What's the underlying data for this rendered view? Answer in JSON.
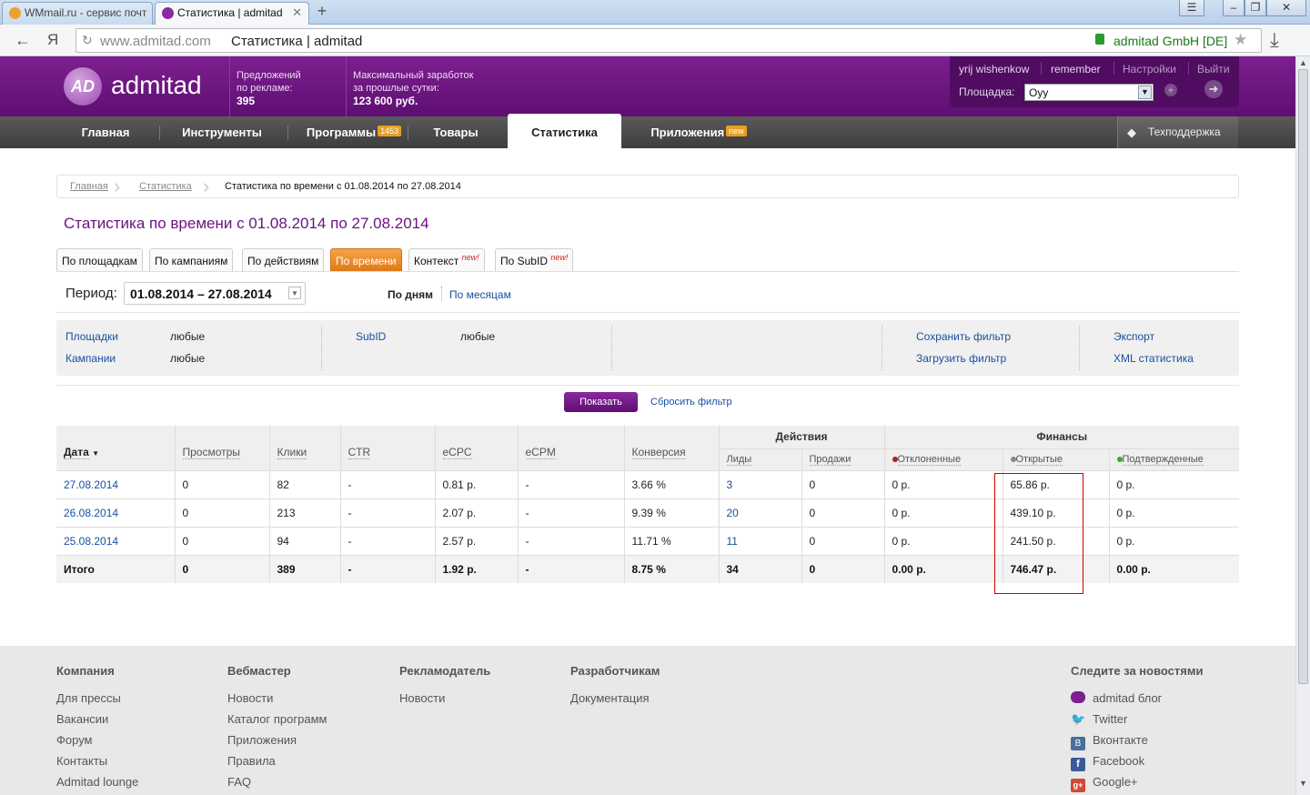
{
  "browser": {
    "tabs": [
      {
        "title": "WMmail.ru - сервис почт",
        "active": false
      },
      {
        "title": "Статистика | admitad",
        "active": true
      }
    ],
    "url_domain": "www.admitad.com",
    "url_title": "Статистика | admitad",
    "cert_label": "admitad GmbH [DE]",
    "yandex_label": "Я"
  },
  "header": {
    "logo_text": "admitad",
    "logo_mark": "AD",
    "offers_label_1": "Предложений",
    "offers_label_2": "по рекламе:",
    "offers_value": "395",
    "earn_label_1": "Максимальный заработок",
    "earn_label_2": "за прошлые сутки:",
    "earn_value": "123 600 руб.",
    "user": "yrij wishenkow",
    "remember": "remember",
    "settings": "Настройки",
    "logout": "Выйти",
    "platform_label": "Площадка:",
    "platform_value": "Oyy"
  },
  "nav": {
    "items": [
      {
        "label": "Главная",
        "badge": ""
      },
      {
        "label": "Инструменты",
        "badge": ""
      },
      {
        "label": "Программы",
        "badge": "1453"
      },
      {
        "label": "Товары",
        "badge": ""
      },
      {
        "label": "Статистика",
        "badge": ""
      },
      {
        "label": "Приложения",
        "badge": "new"
      }
    ],
    "support": "Техподдержка"
  },
  "breadcrumb": {
    "home": "Главная",
    "stats": "Статистика",
    "current": "Статистика по времени с 01.08.2014 по 27.08.2014"
  },
  "page_title": "Статистика по времени с 01.08.2014 по 27.08.2014",
  "subtabs": [
    {
      "label": "По площадкам",
      "new": ""
    },
    {
      "label": "По кампаниям",
      "new": ""
    },
    {
      "label": "По действиям",
      "new": ""
    },
    {
      "label": "По времени",
      "new": ""
    },
    {
      "label": "Контекст",
      "new": "new!"
    },
    {
      "label": "По SubID",
      "new": "new!"
    }
  ],
  "period": {
    "label": "Период:",
    "value": "01.08.2014 – 27.08.2014",
    "by_days": "По дням",
    "by_months": "По месяцам"
  },
  "filter": {
    "sites_label": "Площадки",
    "sites_value": "любые",
    "campaigns_label": "Кампании",
    "campaigns_value": "любые",
    "subid_label": "SubID",
    "subid_value": "любые",
    "save_filter": "Сохранить фильтр",
    "load_filter": "Загрузить фильтр",
    "export": "Экспорт",
    "xml": "XML статистика",
    "show_button": "Показать",
    "reset": "Сбросить фильтр"
  },
  "table": {
    "group_actions": "Действия",
    "group_finance": "Финансы",
    "headers": [
      "Дата",
      "Просмотры",
      "Клики",
      "CTR",
      "eCPC",
      "eCPM",
      "Конверсия"
    ],
    "sub_headers": [
      "Лиды",
      "Продажи",
      "Отклоненные",
      "Открытые",
      "Подтвержденные"
    ],
    "status_colors": {
      "rejected": "#b22222",
      "open": "#888888",
      "confirmed": "#33aa33"
    },
    "rows": [
      [
        "27.08.2014",
        "0",
        "82",
        "-",
        "0.81 р.",
        "-",
        "3.66 %",
        "3",
        "0",
        "0 р.",
        "65.86 р.",
        "0 р."
      ],
      [
        "26.08.2014",
        "0",
        "213",
        "-",
        "2.07 р.",
        "-",
        "9.39 %",
        "20",
        "0",
        "0 р.",
        "439.10 р.",
        "0 р."
      ],
      [
        "25.08.2014",
        "0",
        "94",
        "-",
        "2.57 р.",
        "-",
        "11.71 %",
        "11",
        "0",
        "0 р.",
        "241.50 р.",
        "0 р."
      ]
    ],
    "total": [
      "Итого",
      "0",
      "389",
      "-",
      "1.92 р.",
      "-",
      "8.75 %",
      "34",
      "0",
      "0.00 р.",
      "746.47 р.",
      "0.00 р."
    ]
  },
  "footer": {
    "columns": [
      {
        "title": "Компания",
        "links": [
          "Для прессы",
          "Вакансии",
          "Форум",
          "Контакты",
          "Admitad lounge"
        ]
      },
      {
        "title": "Вебмастер",
        "links": [
          "Новости",
          "Каталог программ",
          "Приложения",
          "Правила",
          "FAQ"
        ]
      },
      {
        "title": "Рекламодатель",
        "links": [
          "Новости"
        ]
      },
      {
        "title": "Разработчикам",
        "links": [
          "Документация"
        ]
      }
    ],
    "social_title": "Следите за новостями",
    "social": [
      {
        "label": "admitad блог",
        "icon": "admitad-icon",
        "color": "#7d1f8f"
      },
      {
        "label": "Twitter",
        "icon": "twitter-icon",
        "color": "#3aa8e0"
      },
      {
        "label": "Вконтакте",
        "icon": "vk-icon",
        "color": "#4a6f9a"
      },
      {
        "label": "Facebook",
        "icon": "facebook-icon",
        "color": "#3b5998"
      },
      {
        "label": "Google+",
        "icon": "googleplus-icon",
        "color": "#d34836"
      }
    ]
  },
  "colors": {
    "brand_purple": "#6b1480",
    "accent_orange": "#ef8c2a",
    "highlight_box": "#cc0000"
  }
}
